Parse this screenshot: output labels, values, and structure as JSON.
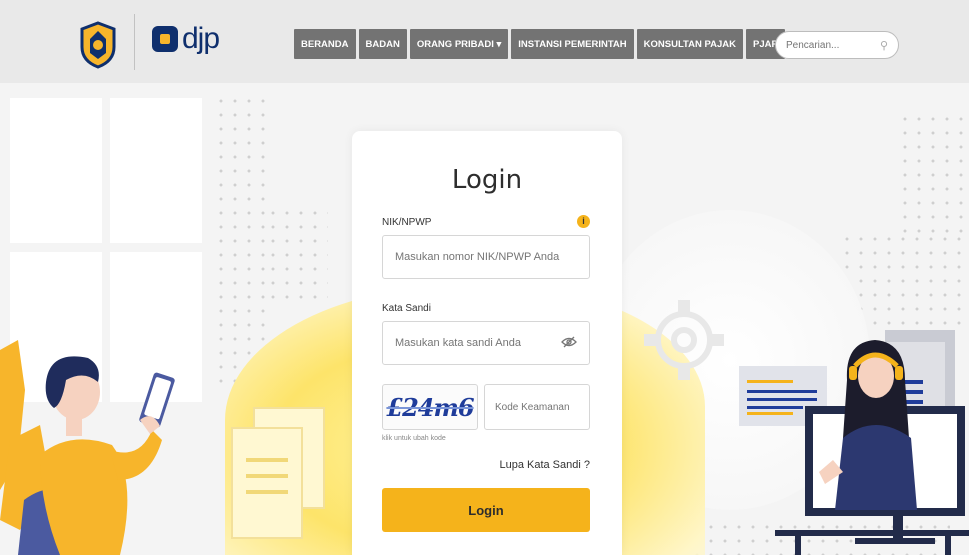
{
  "header": {
    "logo_text": "djp",
    "nav": [
      {
        "label": "BERANDA",
        "name": "nav-beranda"
      },
      {
        "label": "BADAN",
        "name": "nav-badan"
      },
      {
        "label": "ORANG PRIBADI ▾",
        "name": "nav-orang-pribadi"
      },
      {
        "label": "INSTANSI PEMERINTAH",
        "name": "nav-instansi-pemerintah"
      },
      {
        "label": "KONSULTAN PAJAK",
        "name": "nav-konsultan-pajak"
      },
      {
        "label": "PJAP",
        "name": "nav-pjap"
      }
    ],
    "search": {
      "placeholder": "Pencarian...",
      "icon": "search-icon"
    }
  },
  "login": {
    "title": "Login",
    "nik_label": "NIK/NPWP",
    "nik_placeholder": "Masukan nomor NIK/NPWP Anda",
    "info_icon": "info-icon",
    "password_label": "Kata Sandi",
    "password_placeholder": "Masukan kata sandi Anda",
    "password_icon": "eye-slash-icon",
    "captcha_text": "£24m6",
    "captcha_hint": "klik untuk ubah kode",
    "code_placeholder": "Kode Keamanan",
    "forgot_label": "Lupa Kata Sandi ?",
    "submit_label": "Login"
  },
  "colors": {
    "accent": "#f5b31b",
    "nav_bg": "#737373",
    "brand_navy": "#0f2f6d"
  }
}
